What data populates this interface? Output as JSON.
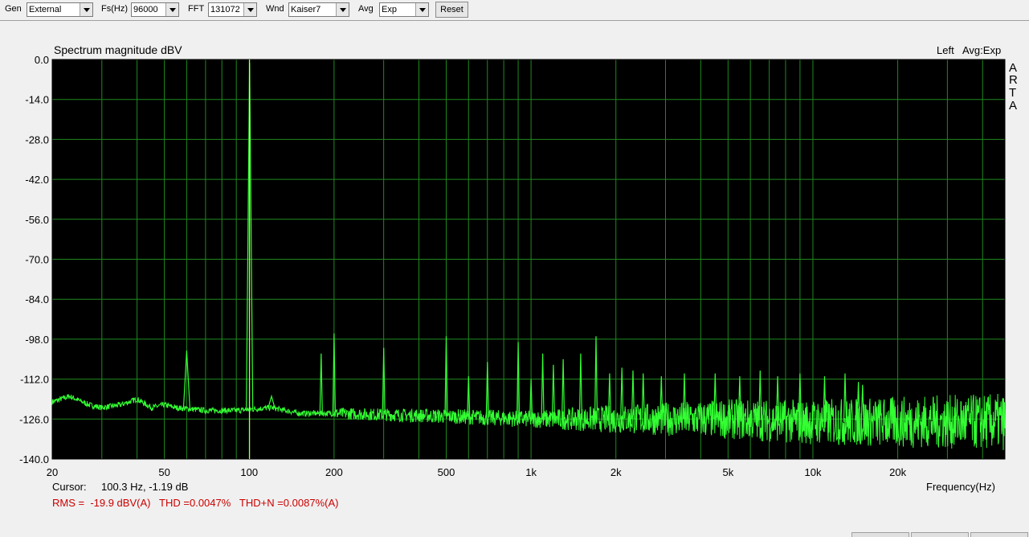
{
  "toolbar": {
    "gen_label": "Gen",
    "gen_value": "External",
    "fs_label": "Fs(Hz)",
    "fs_value": "96000",
    "fft_label": "FFT",
    "fft_value": "131072",
    "wnd_label": "Wnd",
    "wnd_value": "Kaiser7",
    "avg_label": "Avg",
    "avg_value": "Exp",
    "reset_label": "Reset"
  },
  "chart": {
    "title": "Spectrum magnitude dBV",
    "channel": "Left",
    "avg_mode": "Avg:Exp",
    "watermark": [
      "A",
      "R",
      "T",
      "A"
    ],
    "xlabel": "Frequency(Hz)",
    "cursor_label": "Cursor:",
    "cursor_value": "100.3 Hz, -1.19 dB",
    "measurements": "RMS =  -19.9 dBV(A)   THD =0.0047%   THD+N =0.0087%(A)"
  },
  "colors": {
    "plot_bg": "#000000",
    "grid": "#1f8a1f",
    "trace": "#33ff33",
    "measurement_text": "#cc0000"
  },
  "chart_data": {
    "type": "line",
    "xscale": "log",
    "xlim": [
      20,
      48000
    ],
    "ylim": [
      -140,
      0
    ],
    "yticks": [
      "0.0",
      "-14.0",
      "-28.0",
      "-42.0",
      "-56.0",
      "-70.0",
      "-84.0",
      "-98.0",
      "-112.0",
      "-126.0",
      "-140.0"
    ],
    "xticks": [
      {
        "v": 20,
        "label": "20"
      },
      {
        "v": 50,
        "label": "50"
      },
      {
        "v": 100,
        "label": "100"
      },
      {
        "v": 200,
        "label": "200"
      },
      {
        "v": 500,
        "label": "500"
      },
      {
        "v": 1000,
        "label": "1k"
      },
      {
        "v": 2000,
        "label": "2k"
      },
      {
        "v": 5000,
        "label": "5k"
      },
      {
        "v": 10000,
        "label": "10k"
      },
      {
        "v": 20000,
        "label": "20k"
      }
    ],
    "cursor_x": 100.3,
    "noise_floor": [
      [
        20,
        -120
      ],
      [
        23,
        -118
      ],
      [
        27,
        -121
      ],
      [
        30,
        -122
      ],
      [
        35,
        -121
      ],
      [
        40,
        -119
      ],
      [
        45,
        -122
      ],
      [
        50,
        -121
      ],
      [
        55,
        -122
      ],
      [
        70,
        -123
      ],
      [
        90,
        -123
      ],
      [
        120,
        -122
      ],
      [
        150,
        -124
      ],
      [
        200,
        -124
      ],
      [
        500,
        -125
      ],
      [
        1000,
        -126
      ],
      [
        2000,
        -126
      ],
      [
        5000,
        -126
      ],
      [
        10000,
        -127
      ],
      [
        20000,
        -127
      ],
      [
        48000,
        -127
      ]
    ],
    "noise_spread": [
      [
        200,
        2
      ],
      [
        1000,
        3
      ],
      [
        2000,
        5
      ],
      [
        5000,
        7
      ],
      [
        10000,
        8
      ],
      [
        20000,
        9
      ],
      [
        48000,
        10
      ]
    ],
    "peaks": [
      {
        "f": 60,
        "db": -102
      },
      {
        "f": 100.3,
        "db": -1.19
      },
      {
        "f": 120,
        "db": -118
      },
      {
        "f": 180,
        "db": -103
      },
      {
        "f": 200,
        "db": -96
      },
      {
        "f": 300,
        "db": -101
      },
      {
        "f": 500,
        "db": -97
      },
      {
        "f": 600,
        "db": -111
      },
      {
        "f": 700,
        "db": -106
      },
      {
        "f": 900,
        "db": -99
      },
      {
        "f": 1000,
        "db": -112
      },
      {
        "f": 1100,
        "db": -103
      },
      {
        "f": 1200,
        "db": -107
      },
      {
        "f": 1300,
        "db": -105
      },
      {
        "f": 1500,
        "db": -103
      },
      {
        "f": 1700,
        "db": -97
      },
      {
        "f": 1900,
        "db": -110
      },
      {
        "f": 2100,
        "db": -108
      },
      {
        "f": 2300,
        "db": -109
      },
      {
        "f": 2500,
        "db": -110
      },
      {
        "f": 2900,
        "db": -111
      },
      {
        "f": 3500,
        "db": -110
      },
      {
        "f": 4500,
        "db": -110
      },
      {
        "f": 5500,
        "db": -111
      },
      {
        "f": 6500,
        "db": -109
      },
      {
        "f": 7500,
        "db": -111
      },
      {
        "f": 9000,
        "db": -110
      },
      {
        "f": 11000,
        "db": -111
      },
      {
        "f": 13000,
        "db": -110
      },
      {
        "f": 14500,
        "db": -113
      },
      {
        "f": 15000,
        "db": -114
      }
    ]
  }
}
